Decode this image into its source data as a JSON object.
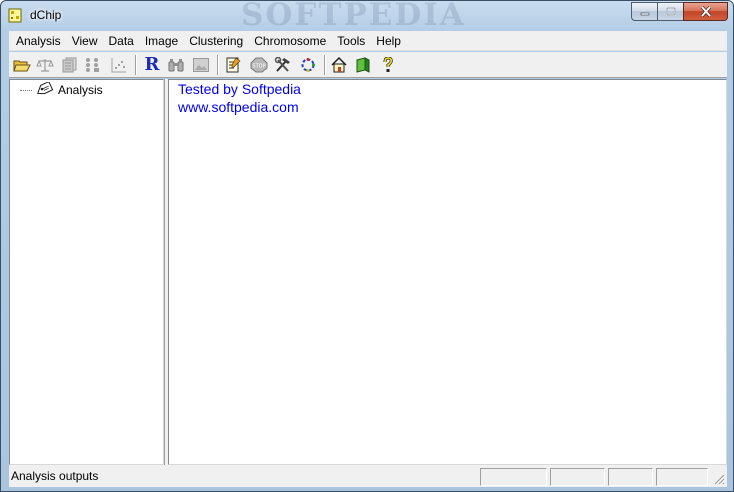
{
  "window": {
    "title": "dChip",
    "watermark": "SOFTPEDIA"
  },
  "menu": [
    {
      "label": "Analysis",
      "name": "menu-analysis"
    },
    {
      "label": "View",
      "name": "menu-view"
    },
    {
      "label": "Data",
      "name": "menu-data"
    },
    {
      "label": "Image",
      "name": "menu-image"
    },
    {
      "label": "Clustering",
      "name": "menu-clustering"
    },
    {
      "label": "Chromosome",
      "name": "menu-chromosome"
    },
    {
      "label": "Tools",
      "name": "menu-tools"
    },
    {
      "label": "Help",
      "name": "menu-help"
    }
  ],
  "toolbar": {
    "r_label": "R"
  },
  "tree": {
    "root_label": "Analysis"
  },
  "output": {
    "line1": "Tested by Softpedia",
    "line2": "www.softpedia.com"
  },
  "status": {
    "text": "Analysis outputs"
  },
  "colors": {
    "link_text": "#0000ee",
    "accent_green": "#22aa22",
    "accent_blue": "#1a2fb8"
  }
}
